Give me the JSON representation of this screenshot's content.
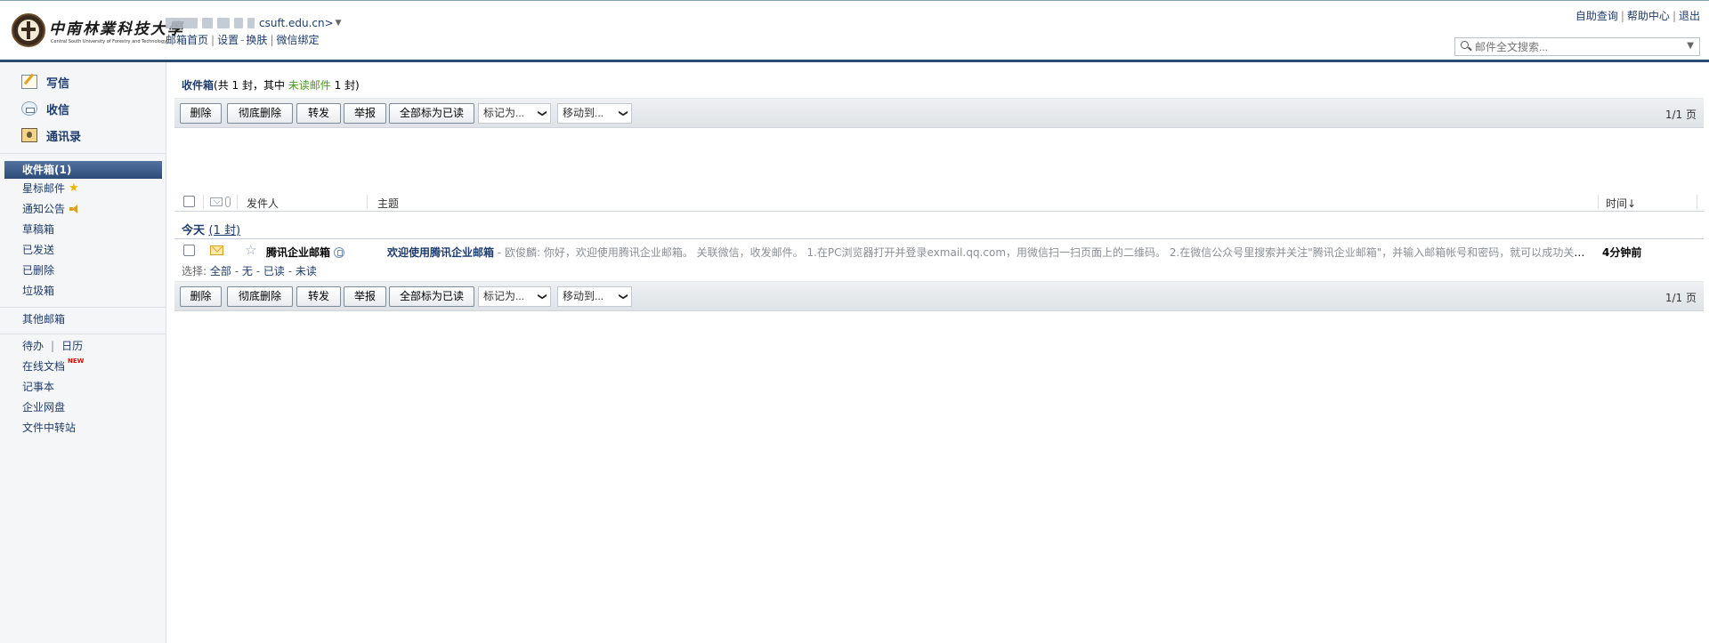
{
  "header": {
    "logo_text": "中南林業科技大學",
    "logo_subtitle": "Central South University of Forestry and Technology",
    "account_domain": "csuft.edu.cn>",
    "subnav": [
      "邮箱首页",
      "设置",
      "换肤",
      "微信绑定"
    ],
    "top_links": [
      "自助查询",
      "帮助中心",
      "退出"
    ],
    "search_placeholder": "邮件全文搜索..."
  },
  "sidebar": {
    "actions": [
      {
        "label": "写信",
        "icon": "compose-icon"
      },
      {
        "label": "收信",
        "icon": "inbox-receive-icon"
      },
      {
        "label": "通讯录",
        "icon": "address-book-icon"
      }
    ],
    "inbox_label": "收件箱(1)",
    "folders": [
      "星标邮件",
      "通知公告",
      "草稿箱",
      "已发送",
      "已删除",
      "垃圾箱"
    ],
    "other_mailbox": "其他邮箱",
    "tools": {
      "todo": "待办",
      "separator": "|",
      "calendar": "日历",
      "online_docs": "在线文档",
      "new_badge": "NEW",
      "notebook": "记事本",
      "netdisk": "企业网盘",
      "transfer": "文件中转站"
    }
  },
  "main": {
    "title": "收件箱",
    "summary_pre": "(共 1 封，其中 ",
    "summary_unread": "未读邮件",
    "summary_post": " 1 封)",
    "toolbar": {
      "delete": "删除",
      "purge": "彻底删除",
      "forward": "转发",
      "report": "举报",
      "mark_all_read": "全部标为已读",
      "mark_as": "标记为...",
      "move_to": "移动到...",
      "pager": "1/1 页"
    },
    "columns": {
      "sender": "发件人",
      "subject": "主题",
      "time": "时间↓"
    },
    "group": {
      "label": "今天",
      "count": "(1 封)"
    },
    "emails": [
      {
        "sender": "腾讯企业邮箱",
        "subject": "欢迎使用腾讯企业邮箱",
        "preview": " - 欧俊麟: 你好，欢迎使用腾讯企业邮箱。 关联微信，收发邮件。 1.在PC浏览器打开并登录exmail.qq.com，用微信扫一扫页面上的二维码。 2.在微信公众号里搜索并关注\"腾讯企业邮箱\"，并输入邮箱帐号和密码，就可以成功关联。...",
        "time": "4分钟前",
        "unread": true,
        "starred": false
      }
    ],
    "select_bar": {
      "label": "选择:",
      "all": "全部",
      "none": "无",
      "read": "已读",
      "unread": "未读",
      "dash": "-"
    }
  },
  "colors": {
    "brand_dark": "#2a4b6e",
    "link": "#1e3c6e",
    "unread_green": "#4a9a1c",
    "active_folder": "#3a5a86"
  }
}
